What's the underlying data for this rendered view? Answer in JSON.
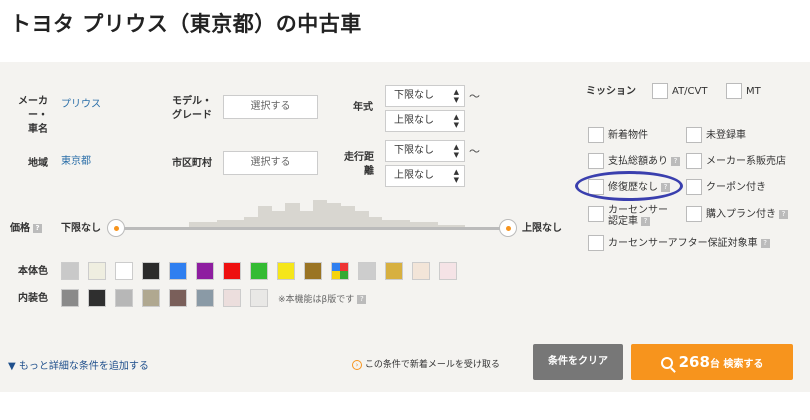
{
  "title": "トヨタ プリウス（東京都）の中古車",
  "filters": {
    "maker_label": "メーカー・\n車名",
    "maker_value": "プリウス",
    "model_label": "モデル・\nグレード",
    "model_button": "選択する",
    "year_label": "年式",
    "year_min": "下限なし",
    "year_max": "上限なし",
    "region_label": "地域",
    "region_value": "東京都",
    "city_label": "市区町村",
    "city_button": "選択する",
    "mileage_label": "走行距\n離",
    "mileage_min": "下限なし",
    "mileage_max": "上限なし",
    "tilde": "〜",
    "price_label": "価格",
    "price_min": "下限なし",
    "price_max": "上限なし",
    "price_histogram": [
      0,
      0,
      0,
      0,
      0,
      0.2,
      0.2,
      0.3,
      0.3,
      0.4,
      0.8,
      0.6,
      0.9,
      0.6,
      1.0,
      0.9,
      0.8,
      0.6,
      0.4,
      0.3,
      0.3,
      0.2,
      0.2,
      0.1,
      0.1,
      0,
      0,
      0
    ],
    "body_color_label": "本体色",
    "interior_color_label": "内装色",
    "beta_note": "※本機能はβ版です"
  },
  "body_colors": [
    "#c9c9c9",
    "#efeee0",
    "#ffffff",
    "#2b2b2b",
    "#2f7ff0",
    "#8e1ea0",
    "#ee1010",
    "#33bb33",
    "#f5e61a",
    "#9a7424",
    "multi",
    "#cdcdcd",
    "#d7b040",
    "#f3e5d8",
    "#f5e3e6"
  ],
  "interior_colors": [
    "#8a8a8a",
    "#2f2f2f",
    "#b7b7b7",
    "#b0a890",
    "#7a5f5a",
    "#8a9aa6",
    "#ecdedd",
    "#e9e8e6"
  ],
  "transmission": {
    "label": "ミッション",
    "options": [
      "AT/CVT",
      "MT"
    ]
  },
  "options": [
    "新着物件",
    "未登録車",
    "支払総額あり",
    "メーカー系販売店",
    "修復歴なし",
    "クーポン付き",
    "カーセンサー\n認定車",
    "購入プラン付き",
    "カーセンサーアフター保証対象車"
  ],
  "help_mark": "?",
  "footer": {
    "more_conditions": "もっと詳細な条件を追加する",
    "mail_notice": "この条件で新着メールを受け取る",
    "clear_button": "条件をクリア",
    "result_count": "268",
    "result_unit": "台 検索する",
    "accent_color": "#f7941d"
  }
}
